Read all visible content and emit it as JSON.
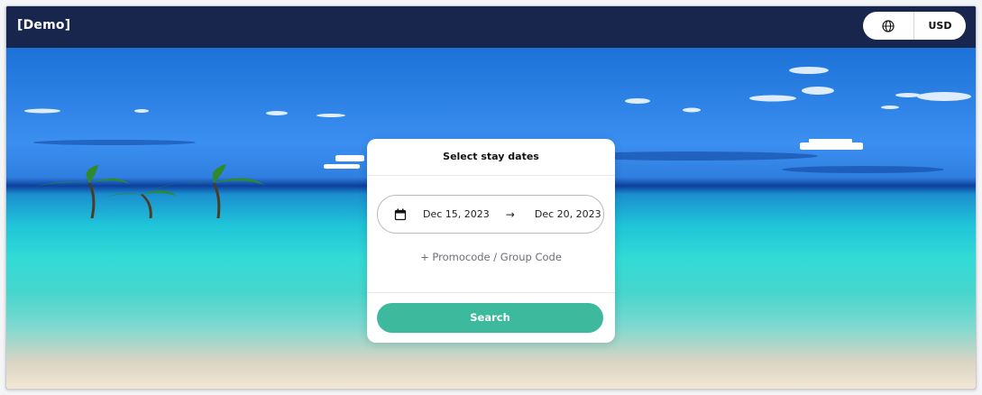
{
  "header": {
    "brand": "[Demo]",
    "currency": "USD",
    "globe_icon": "globe-icon"
  },
  "booking": {
    "title": "Select stay dates",
    "check_in": "Dec 15, 2023",
    "check_out": "Dec 20, 2023",
    "promo_link": "+ Promocode / Group Code",
    "search_label": "Search"
  },
  "colors": {
    "topbar": "#18264d",
    "accent": "#3dba9e"
  }
}
